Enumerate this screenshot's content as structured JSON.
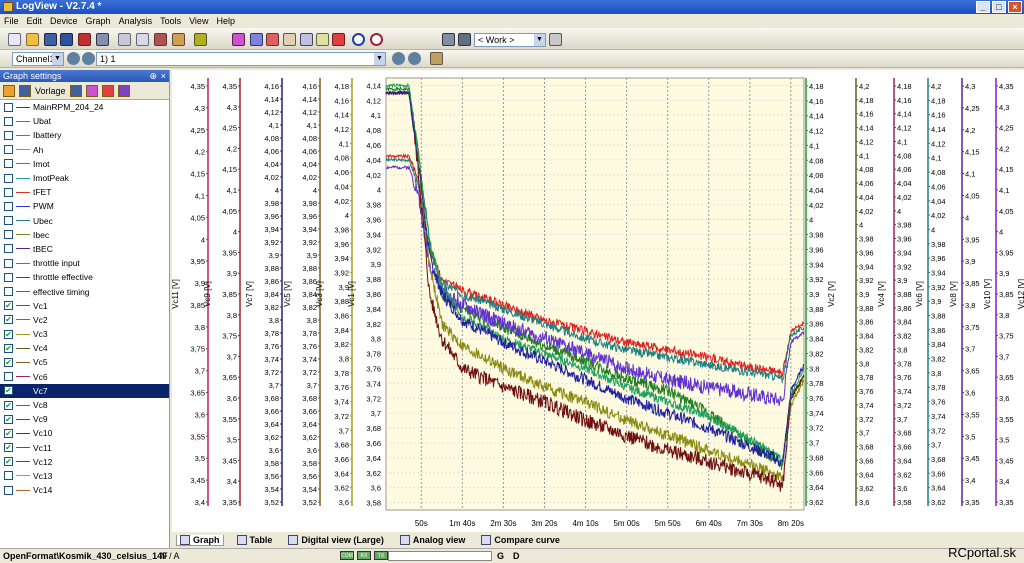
{
  "window": {
    "title": "LogView - V2.7.4 *"
  },
  "menu": [
    "File",
    "Edit",
    "Device",
    "Graph",
    "Analysis",
    "Tools",
    "View",
    "Help"
  ],
  "toolbar": {
    "work_select": "< Work >"
  },
  "toolbar2": {
    "channel_select": "Channel1",
    "record_select": "1) 1"
  },
  "graph_settings": {
    "title": "Graph settings",
    "vorlage": "Vorlage",
    "items": [
      {
        "label": "MainRPM_204_24",
        "checked": false,
        "color": "#5a2a8a"
      },
      {
        "label": "Ubat",
        "checked": false,
        "color": "#a06030"
      },
      {
        "label": "Ibattery",
        "checked": false,
        "color": "#30a030"
      },
      {
        "label": "Ah",
        "checked": false,
        "color": "#c09020"
      },
      {
        "label": "Imot",
        "checked": false,
        "color": "#d030d0"
      },
      {
        "label": "ImotPeak",
        "checked": false,
        "color": "#20a0a0"
      },
      {
        "label": "tFET",
        "checked": false,
        "color": "#e03030"
      },
      {
        "label": "PWM",
        "checked": false,
        "color": "#3030e0"
      },
      {
        "label": "Ubec",
        "checked": false,
        "color": "#208080"
      },
      {
        "label": "Ibec",
        "checked": false,
        "color": "#808020"
      },
      {
        "label": "tBEC",
        "checked": false,
        "color": "#602080"
      },
      {
        "label": "throttle input",
        "checked": false,
        "color": "#20a060"
      },
      {
        "label": "throttle effective",
        "checked": false,
        "color": "#a02020"
      },
      {
        "label": "effective timing",
        "checked": false,
        "color": "#606060"
      },
      {
        "label": "Vc1",
        "checked": true,
        "color": "#208020"
      },
      {
        "label": "Vc2",
        "checked": true,
        "color": "#20a020"
      },
      {
        "label": "Vc3",
        "checked": true,
        "color": "#a0a020"
      },
      {
        "label": "Vc4",
        "checked": true,
        "color": "#606020"
      },
      {
        "label": "Vc5",
        "checked": true,
        "color": "#806020"
      },
      {
        "label": "Vc6",
        "checked": false,
        "color": "#a02060"
      },
      {
        "label": "Vc7",
        "checked": true,
        "color": "#202080",
        "selected": true
      },
      {
        "label": "Vc8",
        "checked": true,
        "color": "#208080"
      },
      {
        "label": "Vc9",
        "checked": true,
        "color": "#a02020"
      },
      {
        "label": "Vc10",
        "checked": true,
        "color": "#6020a0"
      },
      {
        "label": "Vc11",
        "checked": true,
        "color": "#c02060"
      },
      {
        "label": "Vc12",
        "checked": true,
        "color": "#8020c0"
      },
      {
        "label": "Vc13",
        "checked": false,
        "color": "#c0a020"
      },
      {
        "label": "Vc14",
        "checked": false,
        "color": "#c06020"
      }
    ]
  },
  "chart_data": {
    "type": "line",
    "x_tick_labels": [
      "50s",
      "1m 40s",
      "2m 30s",
      "3m 20s",
      "4m 10s",
      "5m 00s",
      "5m 50s",
      "6m 40s",
      "7m 30s",
      "8m 20s"
    ],
    "x_range_seconds": [
      7,
      516
    ],
    "primary_axis": {
      "label": "Vc1 [V]",
      "range": [
        3.57,
        4.15
      ],
      "ticks": [
        "4,14",
        "4,12",
        "4,1",
        "4,08",
        "4,06",
        "4,04",
        "4,02",
        "4",
        "3,98",
        "3,96",
        "3,94",
        "3,92",
        "3,9",
        "3,88",
        "3,86",
        "3,84",
        "3,82",
        "3,8",
        "3,78",
        "3,76",
        "3,74",
        "3,72",
        "3,7",
        "3,68",
        "3,66",
        "3,64",
        "3,62",
        "3,6",
        "3,58"
      ]
    },
    "left_axes": [
      {
        "label": "Vc11 [V]",
        "color": "#c02060",
        "ticks": [
          "4,35",
          "4,3",
          "4,25",
          "4,2",
          "4,15",
          "4,1",
          "4,05",
          "4",
          "3,95",
          "3,9",
          "3,85",
          "3,8",
          "3,75",
          "3,7",
          "3,65",
          "3,6",
          "3,55",
          "3,5",
          "3,45",
          "3,4"
        ]
      },
      {
        "label": "Vc9 [V]",
        "color": "#a02020",
        "ticks": [
          "4,35",
          "4,3",
          "4,25",
          "4,2",
          "4,15",
          "4,1",
          "4,05",
          "4",
          "3,95",
          "3,9",
          "3,85",
          "3,8",
          "3,75",
          "3,7",
          "3,65",
          "3,6",
          "3,55",
          "3,5",
          "3,45",
          "3,4",
          "3,35"
        ]
      },
      {
        "label": "Vc7 [V]",
        "color": "#202080",
        "ticks": [
          "4,16",
          "4,14",
          "4,12",
          "4,1",
          "4,08",
          "4,06",
          "4,04",
          "4,02",
          "4",
          "3,98",
          "3,96",
          "3,94",
          "3,92",
          "3,9",
          "3,88",
          "3,86",
          "3,84",
          "3,82",
          "3,8",
          "3,78",
          "3,76",
          "3,74",
          "3,72",
          "3,7",
          "3,68",
          "3,66",
          "3,64",
          "3,62",
          "3,6",
          "3,58",
          "3,56",
          "3,54",
          "3,52"
        ]
      },
      {
        "label": "Vc5 [V]",
        "color": "#806020",
        "ticks": [
          "4,16",
          "4,14",
          "4,12",
          "4,1",
          "4,08",
          "4,06",
          "4,04",
          "4,02",
          "4",
          "3,98",
          "3,96",
          "3,94",
          "3,92",
          "3,9",
          "3,88",
          "3,86",
          "3,84",
          "3,82",
          "3,8",
          "3,78",
          "3,76",
          "3,74",
          "3,72",
          "3,7",
          "3,68",
          "3,66",
          "3,64",
          "3,62",
          "3,6",
          "3,58",
          "3,56",
          "3,54",
          "3,52"
        ]
      },
      {
        "label": "Vc3 [V]",
        "color": "#a0a020",
        "ticks": [
          "4,18",
          "4,16",
          "4,14",
          "4,12",
          "4,1",
          "4,08",
          "4,06",
          "4,04",
          "4,02",
          "4",
          "3,98",
          "3,96",
          "3,94",
          "3,92",
          "3,9",
          "3,88",
          "3,86",
          "3,84",
          "3,82",
          "3,8",
          "3,78",
          "3,76",
          "3,74",
          "3,72",
          "3,7",
          "3,68",
          "3,66",
          "3,64",
          "3,62",
          "3,6"
        ]
      }
    ],
    "right_axes": [
      {
        "label": "Vc2 [V]",
        "color": "#20a020",
        "ticks": [
          "4,18",
          "4,16",
          "4,14",
          "4,12",
          "4,1",
          "4,08",
          "4,06",
          "4,04",
          "4,02",
          "4",
          "3,98",
          "3,96",
          "3,94",
          "3,92",
          "3,9",
          "3,88",
          "3,86",
          "3,84",
          "3,82",
          "3,8",
          "3,78",
          "3,76",
          "3,74",
          "3,72",
          "3,7",
          "3,68",
          "3,66",
          "3,64",
          "3,62"
        ]
      },
      {
        "label": "Vc4 [V]",
        "color": "#606020",
        "ticks": [
          "4,2",
          "4,18",
          "4,16",
          "4,14",
          "4,12",
          "4,1",
          "4,08",
          "4,06",
          "4,04",
          "4,02",
          "4",
          "3,98",
          "3,96",
          "3,94",
          "3,92",
          "3,9",
          "3,88",
          "3,86",
          "3,84",
          "3,82",
          "3,8",
          "3,78",
          "3,76",
          "3,74",
          "3,72",
          "3,7",
          "3,68",
          "3,66",
          "3,64",
          "3,62",
          "3,6"
        ]
      },
      {
        "label": "Vc6 [V]",
        "color": "#a02060",
        "ticks": [
          "4,18",
          "4,16",
          "4,14",
          "4,12",
          "4,1",
          "4,08",
          "4,06",
          "4,04",
          "4,02",
          "4",
          "3,98",
          "3,96",
          "3,94",
          "3,92",
          "3,9",
          "3,88",
          "3,86",
          "3,84",
          "3,82",
          "3,8",
          "3,78",
          "3,76",
          "3,74",
          "3,72",
          "3,7",
          "3,68",
          "3,66",
          "3,64",
          "3,62",
          "3,6",
          "3,58"
        ]
      },
      {
        "label": "Vc8 [V]",
        "color": "#208080",
        "ticks": [
          "4,2",
          "4,18",
          "4,16",
          "4,14",
          "4,12",
          "4,1",
          "4,08",
          "4,06",
          "4,04",
          "4,02",
          "4",
          "3,98",
          "3,96",
          "3,94",
          "3,92",
          "3,9",
          "3,88",
          "3,86",
          "3,84",
          "3,82",
          "3,8",
          "3,78",
          "3,76",
          "3,74",
          "3,72",
          "3,7",
          "3,68",
          "3,66",
          "3,64",
          "3,62"
        ]
      },
      {
        "label": "Vc10 [V]",
        "color": "#6020a0",
        "ticks": [
          "4,3",
          "4,25",
          "4,2",
          "4,15",
          "4,1",
          "4,05",
          "4",
          "3,95",
          "3,9",
          "3,85",
          "3,8",
          "3,75",
          "3,7",
          "3,65",
          "3,6",
          "3,55",
          "3,5",
          "3,45",
          "3,4",
          "3,35"
        ]
      },
      {
        "label": "Vc12 [V]",
        "color": "#8020c0",
        "ticks": [
          "4,35",
          "4,3",
          "4,25",
          "4,2",
          "4,15",
          "4,1",
          "4,05",
          "4",
          "3,95",
          "3,9",
          "3,85",
          "3,8",
          "3,75",
          "3,7",
          "3,65",
          "3,6",
          "3,55",
          "3,5",
          "3,45",
          "3,4",
          "3,35"
        ]
      }
    ],
    "series": [
      {
        "color": "#e02020",
        "points": [
          [
            7,
            4.045
          ],
          [
            35,
            4.045
          ],
          [
            45,
            4.02
          ],
          [
            60,
            3.92
          ],
          [
            75,
            3.88
          ],
          [
            100,
            3.865
          ],
          [
            150,
            3.845
          ],
          [
            200,
            3.825
          ],
          [
            250,
            3.81
          ],
          [
            300,
            3.795
          ],
          [
            350,
            3.785
          ],
          [
            400,
            3.775
          ],
          [
            450,
            3.762
          ],
          [
            480,
            3.757
          ],
          [
            490,
            3.752
          ],
          [
            500,
            3.81
          ],
          [
            516,
            3.82
          ]
        ]
      },
      {
        "color": "#208020",
        "points": [
          [
            7,
            4.135
          ],
          [
            35,
            4.135
          ],
          [
            45,
            4.06
          ],
          [
            60,
            3.93
          ],
          [
            75,
            3.86
          ],
          [
            100,
            3.84
          ],
          [
            150,
            3.815
          ],
          [
            200,
            3.79
          ],
          [
            250,
            3.77
          ],
          [
            300,
            3.745
          ],
          [
            350,
            3.73
          ],
          [
            400,
            3.7
          ],
          [
            450,
            3.66
          ],
          [
            480,
            3.64
          ],
          [
            490,
            3.63
          ],
          [
            500,
            3.72
          ],
          [
            516,
            3.75
          ]
        ]
      },
      {
        "color": "#6030d0",
        "points": [
          [
            7,
            4.03
          ],
          [
            35,
            4.03
          ],
          [
            45,
            4.0
          ],
          [
            60,
            3.9
          ],
          [
            75,
            3.865
          ],
          [
            100,
            3.845
          ],
          [
            150,
            3.82
          ],
          [
            200,
            3.8
          ],
          [
            250,
            3.78
          ],
          [
            300,
            3.76
          ],
          [
            350,
            3.745
          ],
          [
            400,
            3.735
          ],
          [
            450,
            3.725
          ],
          [
            480,
            3.72
          ],
          [
            490,
            3.717
          ],
          [
            500,
            3.795
          ],
          [
            516,
            3.81
          ]
        ]
      },
      {
        "color": "#208080",
        "points": [
          [
            7,
            4.04
          ],
          [
            35,
            4.04
          ],
          [
            45,
            4.01
          ],
          [
            60,
            3.92
          ],
          [
            75,
            3.875
          ],
          [
            100,
            3.86
          ],
          [
            150,
            3.84
          ],
          [
            200,
            3.82
          ],
          [
            250,
            3.8
          ],
          [
            300,
            3.785
          ],
          [
            350,
            3.775
          ],
          [
            400,
            3.765
          ],
          [
            450,
            3.755
          ],
          [
            480,
            3.75
          ],
          [
            490,
            3.745
          ],
          [
            500,
            3.805
          ],
          [
            516,
            3.815
          ]
        ]
      },
      {
        "color": "#8a8a10",
        "points": [
          [
            7,
            4.13
          ],
          [
            35,
            4.13
          ],
          [
            45,
            4.05
          ],
          [
            60,
            3.9
          ],
          [
            75,
            3.82
          ],
          [
            100,
            3.79
          ],
          [
            150,
            3.76
          ],
          [
            200,
            3.735
          ],
          [
            250,
            3.715
          ],
          [
            300,
            3.69
          ],
          [
            350,
            3.67
          ],
          [
            400,
            3.65
          ],
          [
            450,
            3.63
          ],
          [
            480,
            3.62
          ],
          [
            490,
            3.61
          ],
          [
            500,
            3.71
          ],
          [
            516,
            3.745
          ]
        ]
      },
      {
        "color": "#701010",
        "points": [
          [
            7,
            4.13
          ],
          [
            35,
            4.13
          ],
          [
            45,
            4.04
          ],
          [
            60,
            3.86
          ],
          [
            75,
            3.8
          ],
          [
            100,
            3.76
          ],
          [
            150,
            3.735
          ],
          [
            200,
            3.715
          ],
          [
            250,
            3.69
          ],
          [
            300,
            3.67
          ],
          [
            350,
            3.65
          ],
          [
            400,
            3.635
          ],
          [
            450,
            3.618
          ],
          [
            480,
            3.61
          ],
          [
            490,
            3.6
          ],
          [
            500,
            3.72
          ],
          [
            516,
            3.75
          ]
        ]
      },
      {
        "color": "#20a060",
        "points": [
          [
            7,
            4.14
          ],
          [
            35,
            4.14
          ],
          [
            45,
            4.06
          ],
          [
            60,
            3.93
          ],
          [
            75,
            3.87
          ],
          [
            100,
            3.83
          ],
          [
            150,
            3.8
          ],
          [
            200,
            3.78
          ],
          [
            250,
            3.76
          ],
          [
            300,
            3.735
          ],
          [
            350,
            3.715
          ],
          [
            400,
            3.695
          ],
          [
            450,
            3.665
          ],
          [
            480,
            3.645
          ],
          [
            490,
            3.635
          ],
          [
            500,
            3.725
          ],
          [
            516,
            3.76
          ]
        ]
      },
      {
        "color": "#2020a0",
        "points": [
          [
            7,
            4.13
          ],
          [
            35,
            4.13
          ],
          [
            45,
            4.05
          ],
          [
            60,
            3.91
          ],
          [
            75,
            3.86
          ],
          [
            100,
            3.825
          ],
          [
            150,
            3.795
          ],
          [
            200,
            3.77
          ],
          [
            250,
            3.745
          ],
          [
            300,
            3.72
          ],
          [
            350,
            3.7
          ],
          [
            400,
            3.68
          ],
          [
            450,
            3.655
          ],
          [
            480,
            3.64
          ],
          [
            490,
            3.632
          ],
          [
            500,
            3.73
          ],
          [
            516,
            3.765
          ]
        ]
      }
    ],
    "grid": true
  },
  "tabs": [
    {
      "label": "Graph",
      "active": true
    },
    {
      "label": "Table",
      "active": false
    },
    {
      "label": "Digital view (Large)",
      "active": false
    },
    {
      "label": "Analog view",
      "active": false
    },
    {
      "label": "Compare curve",
      "active": false
    }
  ],
  "status": {
    "file": "OpenFormat\\Kosmik_430_celsius_14F",
    "na": "N / A",
    "leds": [
      "COM",
      "RX",
      "TX"
    ],
    "g": "G",
    "d": "D",
    "watermark": "RCportal.sk"
  }
}
